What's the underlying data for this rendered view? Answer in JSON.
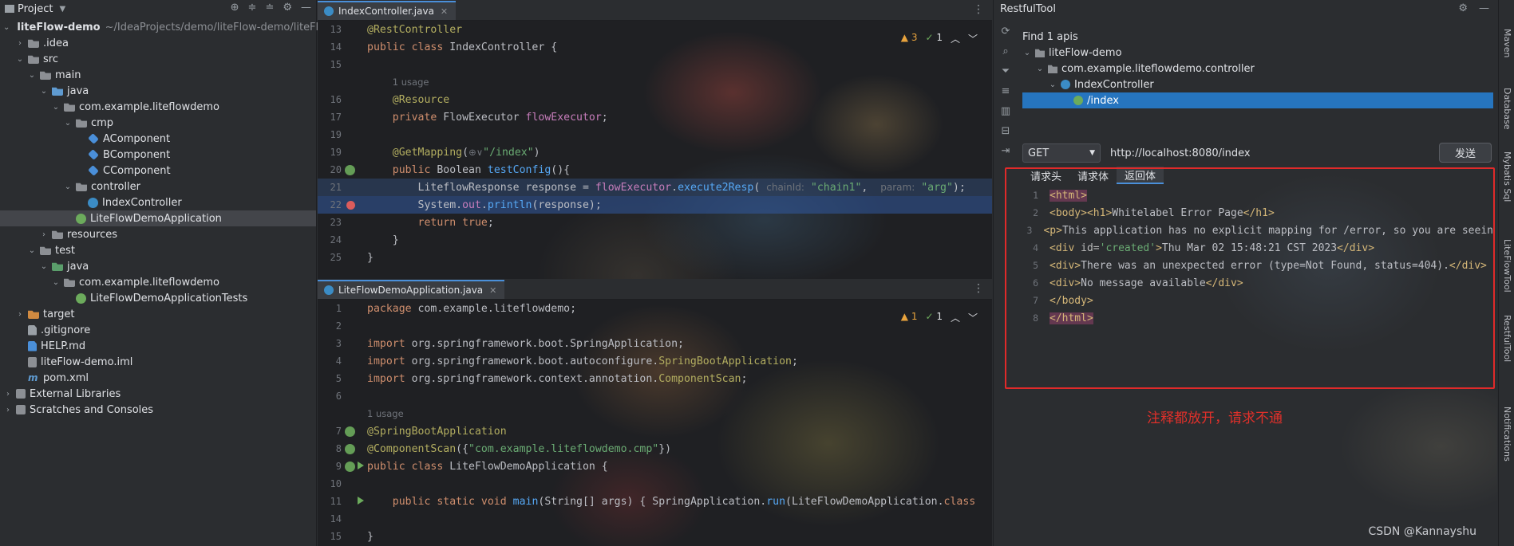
{
  "project": {
    "title": "Project",
    "items": [
      {
        "label": "liteFlow-demo",
        "hint": "~/IdeaProjects/demo/liteFlow-demo/liteFlow",
        "indent": 0,
        "arrow": "down",
        "icon": "folder",
        "bold": true
      },
      {
        "label": ".idea",
        "indent": 1,
        "arrow": "right",
        "icon": "folder"
      },
      {
        "label": "src",
        "indent": 1,
        "arrow": "down",
        "icon": "folder"
      },
      {
        "label": "main",
        "indent": 2,
        "arrow": "down",
        "icon": "folder"
      },
      {
        "label": "java",
        "indent": 3,
        "arrow": "down",
        "icon": "folder-blue"
      },
      {
        "label": "com.example.liteflowdemo",
        "indent": 4,
        "arrow": "down",
        "icon": "pkg"
      },
      {
        "label": "cmp",
        "indent": 5,
        "arrow": "down",
        "icon": "pkg"
      },
      {
        "label": "AComponent",
        "indent": 6,
        "arrow": "",
        "icon": "cube"
      },
      {
        "label": "BComponent",
        "indent": 6,
        "arrow": "",
        "icon": "cube"
      },
      {
        "label": "CComponent",
        "indent": 6,
        "arrow": "",
        "icon": "cube"
      },
      {
        "label": "controller",
        "indent": 5,
        "arrow": "down",
        "icon": "pkg"
      },
      {
        "label": "IndexController",
        "indent": 6,
        "arrow": "",
        "icon": "cls"
      },
      {
        "label": "LiteFlowDemoApplication",
        "indent": 5,
        "arrow": "",
        "icon": "spring",
        "selected": true
      },
      {
        "label": "resources",
        "indent": 3,
        "arrow": "right",
        "icon": "folder"
      },
      {
        "label": "test",
        "indent": 2,
        "arrow": "down",
        "icon": "folder"
      },
      {
        "label": "java",
        "indent": 3,
        "arrow": "down",
        "icon": "folder-green"
      },
      {
        "label": "com.example.liteflowdemo",
        "indent": 4,
        "arrow": "down",
        "icon": "pkg"
      },
      {
        "label": "LiteFlowDemoApplicationTests",
        "indent": 5,
        "arrow": "",
        "icon": "spring"
      },
      {
        "label": "target",
        "indent": 1,
        "arrow": "right",
        "icon": "folder-orange"
      },
      {
        "label": ".gitignore",
        "indent": 1,
        "arrow": "",
        "icon": "file"
      },
      {
        "label": "HELP.md",
        "indent": 1,
        "arrow": "",
        "icon": "md"
      },
      {
        "label": "liteFlow-demo.iml",
        "indent": 1,
        "arrow": "",
        "icon": "iml"
      },
      {
        "label": "pom.xml",
        "indent": 1,
        "arrow": "",
        "icon": "m-icon"
      },
      {
        "label": "External Libraries",
        "indent": 0,
        "arrow": "right",
        "icon": "lib"
      },
      {
        "label": "Scratches and Consoles",
        "indent": 0,
        "arrow": "right",
        "icon": "lib"
      }
    ]
  },
  "editor_top": {
    "tab": "IndexController.java",
    "inspections": {
      "warnings": "3",
      "ok": "1"
    },
    "lines": [
      {
        "n": "13",
        "html": "<span class=\"ann\">@RestController</span>"
      },
      {
        "n": "14",
        "html": "<span class=\"kw\">public class </span>IndexController {"
      },
      {
        "n": "15",
        "html": ""
      },
      {
        "n": "",
        "html": "    <span class=\"usage\">1 usage</span>"
      },
      {
        "n": "16",
        "html": "    <span class=\"ann\">@Resource</span>"
      },
      {
        "n": "17",
        "html": "    <span class=\"kw\">private </span>FlowExecutor <span class=\"fld\">flowExecutor</span>;"
      },
      {
        "n": "19",
        "html": ""
      },
      {
        "n": "19",
        "html": "    <span class=\"ann\">@GetMapping</span>(<span class=\"usage\">⊕∨</span><span class=\"str\">\"/index\"</span>)"
      },
      {
        "n": "20",
        "html": "    <span class=\"kw\">public </span>Boolean <span class=\"fn\">testConfig</span>(){",
        "gut": "spring"
      },
      {
        "n": "21",
        "html": "        LiteflowResponse response = <span class=\"fld\">flowExecutor</span>.<span class=\"fn\">execute2Resp</span>( <span class=\"hint\">chainId:</span> <span class=\"str\">\"chain1\"</span>,  <span class=\"hint\">param:</span> <span class=\"str\">\"arg\"</span>);",
        "hl": "sel"
      },
      {
        "n": "22",
        "html": "        System.<span class=\"fld\">out</span>.<span class=\"fn\">println</span>(response);",
        "hl": "blue",
        "gut": "bp"
      },
      {
        "n": "23",
        "html": "        <span class=\"kw\">return true</span>;"
      },
      {
        "n": "24",
        "html": "    }"
      },
      {
        "n": "25",
        "html": "}"
      }
    ]
  },
  "editor_bottom": {
    "tab": "LiteFlowDemoApplication.java",
    "inspections": {
      "warnings": "1",
      "ok": "1"
    },
    "lines": [
      {
        "n": "1",
        "html": "<span class=\"kw\">package </span>com.example.liteflowdemo;"
      },
      {
        "n": "2",
        "html": ""
      },
      {
        "n": "3",
        "html": "<span class=\"kw\">import </span>org.springframework.boot.SpringApplication;"
      },
      {
        "n": "4",
        "html": "<span class=\"kw\">import </span>org.springframework.boot.autoconfigure.<span class=\"ann\">SpringBootApplication</span>;"
      },
      {
        "n": "5",
        "html": "<span class=\"kw\">import </span>org.springframework.context.annotation.<span class=\"ann\">ComponentScan</span>;"
      },
      {
        "n": "6",
        "html": ""
      },
      {
        "n": "",
        "html": "<span class=\"usage\">1 usage</span>"
      },
      {
        "n": "7",
        "html": "<span class=\"ann\">@SpringBootApplication</span>",
        "gut": "spring"
      },
      {
        "n": "8",
        "html": "<span class=\"ann\">@ComponentScan</span>({<span class=\"str\">\"com.example.liteflowdemo.cmp\"</span>})",
        "gut": "spring"
      },
      {
        "n": "9",
        "html": "<span class=\"kw\">public class </span>LiteFlowDemoApplication {",
        "gut": "spring-run"
      },
      {
        "n": "10",
        "html": ""
      },
      {
        "n": "11",
        "html": "    <span class=\"kw\">public static void </span><span class=\"fn\">main</span>(String[] args) { SpringApplication.<span class=\"fn\">run</span>(LiteFlowDemoApplication.<span class=\"kw\">class</span>",
        "gut": "run"
      },
      {
        "n": "14",
        "html": ""
      },
      {
        "n": "15",
        "html": "}"
      }
    ]
  },
  "restful": {
    "title": "RestfulTool",
    "tree": [
      {
        "label": "Find 1 apis",
        "indent": 0,
        "arrow": "",
        "icon": ""
      },
      {
        "label": "liteFlow-demo",
        "indent": 0,
        "arrow": "down",
        "icon": "folder"
      },
      {
        "label": "com.example.liteflowdemo.controller",
        "indent": 1,
        "arrow": "down",
        "icon": "folder"
      },
      {
        "label": "IndexController",
        "indent": 2,
        "arrow": "down",
        "icon": "cls"
      },
      {
        "label": "/index",
        "indent": 3,
        "arrow": "",
        "icon": "get",
        "selected": true
      }
    ],
    "method": "GET",
    "url": "http://localhost:8080/index",
    "send_label": "发送",
    "tabs": [
      "请求头",
      "请求体",
      "返回体"
    ],
    "active_tab": 2,
    "response_lines": [
      {
        "n": "1",
        "html": "<span class=\"tag tag-hl\">&lt;html&gt;</span>"
      },
      {
        "n": "2",
        "html": "<span class=\"tag\">&lt;body&gt;&lt;h1&gt;</span>Whitelabel Error Page<span class=\"tag\">&lt;/h1&gt;</span>"
      },
      {
        "n": "3",
        "html": "<span class=\"tag\">&lt;p&gt;</span>This application has no explicit mapping for /error, so you are seein"
      },
      {
        "n": "4",
        "html": "<span class=\"tag\">&lt;div </span><span class=\"attr\">id=</span><span class=\"aval\">'created'</span><span class=\"tag\">&gt;</span>Thu Mar 02 15:48:21 CST 2023<span class=\"tag\">&lt;/div&gt;</span>"
      },
      {
        "n": "5",
        "html": "<span class=\"tag\">&lt;div&gt;</span>There was an unexpected error (type=Not Found, status=404).<span class=\"tag\">&lt;/div&gt;</span>"
      },
      {
        "n": "6",
        "html": "<span class=\"tag\">&lt;div&gt;</span>No message available<span class=\"tag\">&lt;/div&gt;</span>"
      },
      {
        "n": "7",
        "html": "<span class=\"tag\">&lt;/body&gt;</span>"
      },
      {
        "n": "8",
        "html": "<span class=\"tag tag-hl\">&lt;/html&gt;</span>"
      }
    ],
    "annotation": "注释都放开，请求不通"
  },
  "right_stripe": [
    "Maven",
    "Database",
    "Mybatis Sql",
    "LiteFlowTool",
    "RestfulTool",
    "Notifications"
  ],
  "watermark": "CSDN @Kannayshu"
}
